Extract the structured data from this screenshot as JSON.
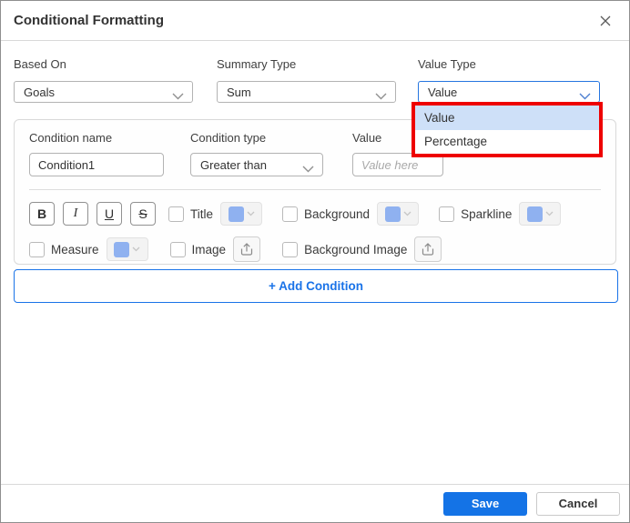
{
  "colors": {
    "accent_blue": "#1a73e8",
    "save_blue": "#1473e6",
    "focus_border": "#2675e0",
    "annotation_red": "#ee0000",
    "option_highlight": "#cee0f8",
    "swatch_blue": "#8fb1f0"
  },
  "dialog": {
    "title": "Conditional Formatting"
  },
  "controls": {
    "based_on": {
      "label": "Based On",
      "value": "Goals"
    },
    "summary_type": {
      "label": "Summary Type",
      "value": "Sum"
    },
    "value_type": {
      "label": "Value Type",
      "value": "Value"
    }
  },
  "value_type_dropdown": {
    "options": [
      {
        "label": "Value"
      },
      {
        "label": "Percentage"
      }
    ]
  },
  "condition": {
    "name": {
      "label": "Condition name",
      "value": "Condition1"
    },
    "type": {
      "label": "Condition type",
      "value": "Greater than"
    },
    "value": {
      "label": "Value",
      "placeholder": "Value here"
    },
    "format_buttons": {
      "bold": "B",
      "italic": "I",
      "underline": "U",
      "strikethrough": "S"
    },
    "toggles": {
      "title": "Title",
      "background": "Background",
      "sparkline": "Sparkline",
      "measure": "Measure",
      "image": "Image",
      "background_image": "Background Image"
    }
  },
  "add_condition": {
    "label": "+ Add Condition"
  },
  "footer": {
    "save": "Save",
    "cancel": "Cancel"
  }
}
